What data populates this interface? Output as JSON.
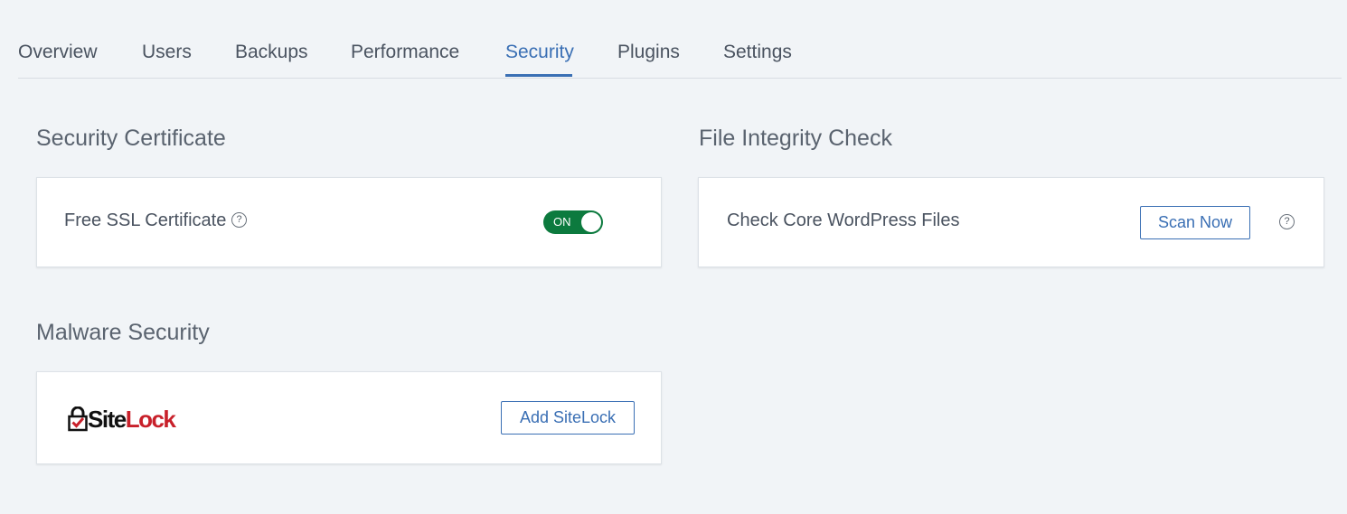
{
  "tabs": [
    {
      "label": "Overview"
    },
    {
      "label": "Users"
    },
    {
      "label": "Backups"
    },
    {
      "label": "Performance"
    },
    {
      "label": "Security"
    },
    {
      "label": "Plugins"
    },
    {
      "label": "Settings"
    }
  ],
  "active_tab": "Security",
  "colors": {
    "accent": "#3a6fb4",
    "toggle_on": "#0c7a3e",
    "background": "#f1f4f7",
    "sitelock_red": "#c8202a"
  },
  "security_certificate": {
    "title": "Security Certificate",
    "ssl_label": "Free SSL Certificate",
    "help_icon": "question-circle-icon",
    "toggle_label": "ON"
  },
  "file_integrity": {
    "title": "File Integrity Check",
    "label": "Check Core WordPress Files",
    "button_label": "Scan Now",
    "help_icon": "question-circle-icon"
  },
  "malware": {
    "title": "Malware Security",
    "logo": {
      "site": "Site",
      "lock": "Lock",
      "mark": "."
    },
    "button_label": "Add SiteLock"
  }
}
